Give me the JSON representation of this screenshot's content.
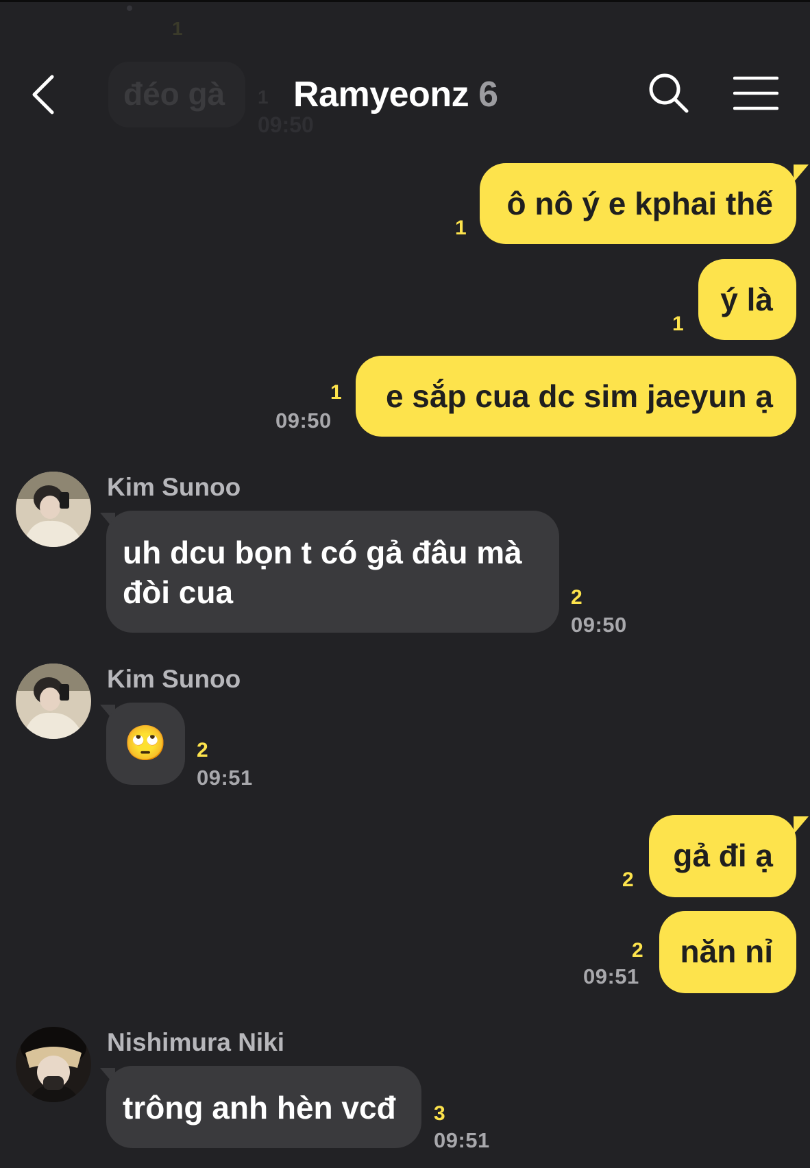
{
  "header": {
    "title": "Ramyeonz",
    "member_count": "6",
    "icons": {
      "back": "back-arrow-icon",
      "search": "search-icon",
      "menu": "hamburger-menu-icon"
    }
  },
  "ghost": {
    "message": "đéo gà",
    "unread_top": "1",
    "unread": "1",
    "time": "09:50"
  },
  "colors": {
    "background": "#222225",
    "outgoing_bubble": "#fde34c",
    "incoming_bubble": "#3a3a3d",
    "unread_count": "#fde34c",
    "timestamp": "#a8a8ac"
  },
  "messages": [
    {
      "direction": "out",
      "text": "ô nô ý e kphai thế",
      "unread": "1"
    },
    {
      "direction": "out",
      "text": "ý là",
      "unread": "1"
    },
    {
      "direction": "out",
      "text": "e sắp cua dc sim jaeyun ạ",
      "unread": "1",
      "time": "09:50"
    },
    {
      "direction": "in",
      "sender": "Kim Sunoo",
      "text": "uh dcu bọn t có gả đâu mà đòi cua",
      "unread": "2",
      "time": "09:50"
    },
    {
      "direction": "in",
      "sender": "Kim Sunoo",
      "text": "🙄",
      "unread": "2",
      "time": "09:51"
    },
    {
      "direction": "out",
      "text": "gả đi ạ",
      "unread": "2"
    },
    {
      "direction": "out",
      "text": "năn nỉ",
      "unread": "2",
      "time": "09:51"
    },
    {
      "direction": "in",
      "sender": "Nishimura Niki",
      "text": "trông anh hèn vcđ",
      "unread": "3",
      "time": "09:51"
    }
  ]
}
